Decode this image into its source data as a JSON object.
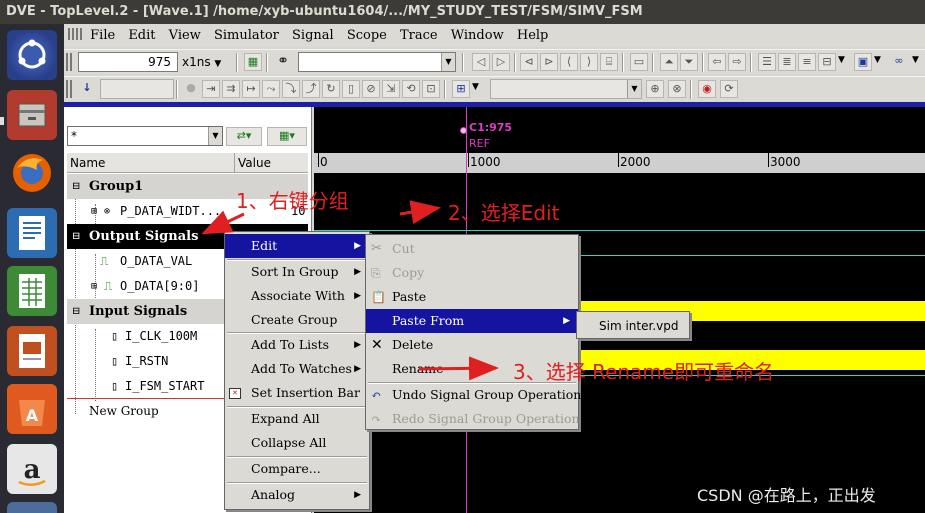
{
  "title": "DVE - TopLevel.2 - [Wave.1]  /home/xyb-ubuntu1604/.../MY_STUDY_TEST/FSM/SIMV_FSM",
  "menubar": [
    "File",
    "Edit",
    "View",
    "Simulator",
    "Signal",
    "Scope",
    "Trace",
    "Window",
    "Help"
  ],
  "toolbar": {
    "time_value": "975",
    "time_unit": "x1ns"
  },
  "signal_pane": {
    "filter_value": "*",
    "columns": {
      "name": "Name",
      "value": "Value"
    },
    "rows": [
      {
        "label": "Group1",
        "kind": "group"
      },
      {
        "label": "P_DATA_WIDT...",
        "value": "10",
        "kind": "param"
      },
      {
        "label": "Output Signals",
        "kind": "group-selected"
      },
      {
        "label": "O_DATA_VAL",
        "kind": "signal"
      },
      {
        "label": "O_DATA[9:0]",
        "kind": "bus"
      },
      {
        "label": "Input Signals",
        "kind": "group"
      },
      {
        "label": "I_CLK_100M",
        "kind": "signal"
      },
      {
        "label": "I_RSTN",
        "kind": "signal"
      },
      {
        "label": "I_FSM_START",
        "kind": "signal"
      },
      {
        "label": "New Group",
        "kind": "group-plain"
      }
    ]
  },
  "wave_pane": {
    "cursor_label": "C1:975",
    "ref_label": "REF",
    "ruler_ticks": [
      "0",
      "1000",
      "2000",
      "3000"
    ]
  },
  "context_menu": {
    "items": [
      {
        "label": "Edit",
        "submenu": true,
        "highlighted": true
      },
      {
        "label": "Sort In Group",
        "submenu": true
      },
      {
        "label": "Associate With",
        "submenu": true
      },
      {
        "label": "Create Group"
      },
      {
        "label": "Add To Lists",
        "submenu": true
      },
      {
        "label": "Add To Watches",
        "submenu": true
      },
      {
        "label": "Set Insertion Bar"
      },
      {
        "label": "Expand All"
      },
      {
        "label": "Collapse All"
      },
      {
        "label": "Compare..."
      },
      {
        "label": "Analog",
        "submenu": true
      }
    ]
  },
  "edit_submenu": {
    "items": [
      {
        "label": "Cut",
        "disabled": true
      },
      {
        "label": "Copy",
        "disabled": true
      },
      {
        "label": "Paste"
      },
      {
        "label": "Paste From",
        "submenu": true,
        "highlighted": true
      },
      {
        "label": "Delete"
      },
      {
        "label": "Rename"
      },
      {
        "label": "Undo Signal Group Operation"
      },
      {
        "label": "Redo Signal Group Operation",
        "disabled": true
      }
    ]
  },
  "paste_from_submenu": {
    "items": [
      {
        "label": "Sim inter.vpd"
      }
    ]
  },
  "annotations": {
    "step1": "1、右键分组",
    "step2": "2、选择Edit",
    "step3": "3、选择 Rename即可重命名"
  },
  "watermark": "CSDN @在路上，正出发",
  "colors": {
    "menu_highlight": "#1414a0",
    "annotation": "#e02020",
    "cursor": "#d63fc0",
    "wave_yellow": "#ffff00"
  }
}
